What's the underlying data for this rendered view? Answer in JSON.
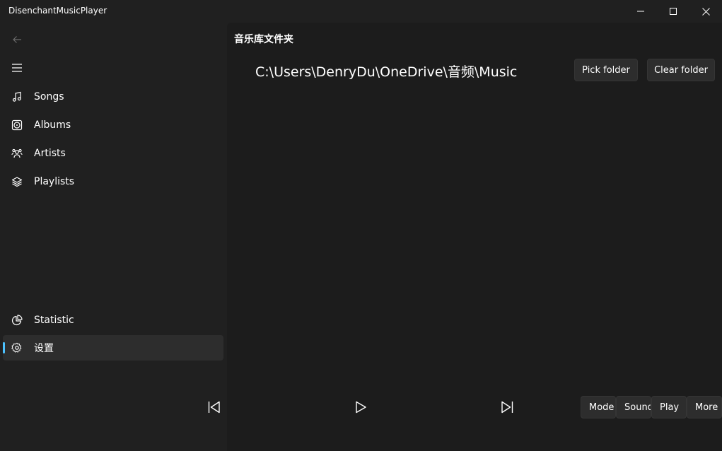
{
  "window": {
    "title": "DisenchantMusicPlayer",
    "controls": [
      "minimize-icon",
      "maximize-icon",
      "close-icon"
    ]
  },
  "sidebar": {
    "back_icon": "back-arrow-icon",
    "menu_icon": "hamburger-icon",
    "items": [
      {
        "label": "Songs",
        "icon": "music-note-icon"
      },
      {
        "label": "Albums",
        "icon": "album-icon"
      },
      {
        "label": "Artists",
        "icon": "artist-icon"
      },
      {
        "label": "Playlists",
        "icon": "layers-icon"
      }
    ],
    "footer_items": [
      {
        "label": "Statistic",
        "icon": "pie-chart-icon"
      },
      {
        "label": "设置",
        "icon": "gear-icon",
        "selected": true
      }
    ]
  },
  "main": {
    "section_title": "音乐库文件夹",
    "folder_path": "C:\\Users\\DenryDu\\OneDrive\\音频\\Music",
    "pick_folder_label": "Pick folder",
    "clear_folder_label": "Clear folder"
  },
  "player": {
    "controls": [
      "previous-icon",
      "play-icon",
      "next-icon"
    ],
    "buttons": [
      "Mode",
      "Sound",
      "Play",
      "More"
    ]
  },
  "colors": {
    "background": "#202020",
    "content_background": "#1c1c1c",
    "accent": "#4cc2ff",
    "button_background": "#2d2d2d"
  }
}
